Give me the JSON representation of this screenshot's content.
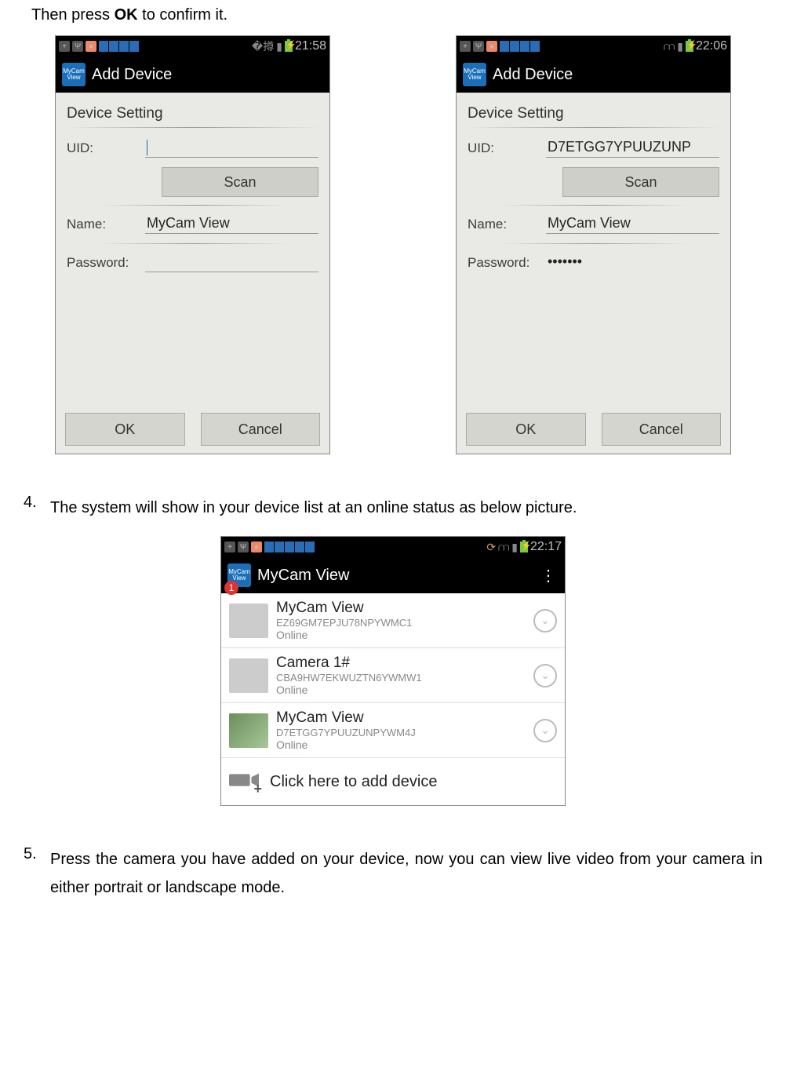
{
  "intro_prefix": "Then press ",
  "intro_bold": "OK",
  "intro_suffix": " to confirm it.",
  "screen_left": {
    "time": "21:58",
    "title": "Add Device",
    "section": "Device Setting",
    "uid_label": "UID:",
    "uid_value": "",
    "scan": "Scan",
    "name_label": "Name:",
    "name_value": "MyCam View",
    "pwd_label": "Password:",
    "pwd_value": "",
    "ok": "OK",
    "cancel": "Cancel"
  },
  "screen_right": {
    "time": "22:06",
    "title": "Add Device",
    "section": "Device Setting",
    "uid_label": "UID:",
    "uid_value": "D7ETGG7YPUUZUNP",
    "scan": "Scan",
    "name_label": "Name:",
    "name_value": "MyCam View",
    "pwd_label": "Password:",
    "pwd_value": "•••••••",
    "ok": "OK",
    "cancel": "Cancel"
  },
  "step4_num": "4.",
  "step4_text": "The system will show in your device list at an online status as below picture.",
  "device_list": {
    "time": "22:17",
    "title": "MyCam View",
    "badge": "1",
    "items": [
      {
        "name": "MyCam View",
        "uid": "EZ69GM7EPJU78NPYWMC1",
        "status": "Online"
      },
      {
        "name": "Camera 1#",
        "uid": "CBA9HW7EKWUZTN6YWMW1",
        "status": "Online"
      },
      {
        "name": "MyCam View",
        "uid": "D7ETGG7YPUUZUNPYWM4J",
        "status": "Online"
      }
    ],
    "add_text": "Click here to add device"
  },
  "step5_num": "5.",
  "step5_text": "Press the camera you have added on your device, now you can view live video from your camera in either portrait or landscape mode."
}
